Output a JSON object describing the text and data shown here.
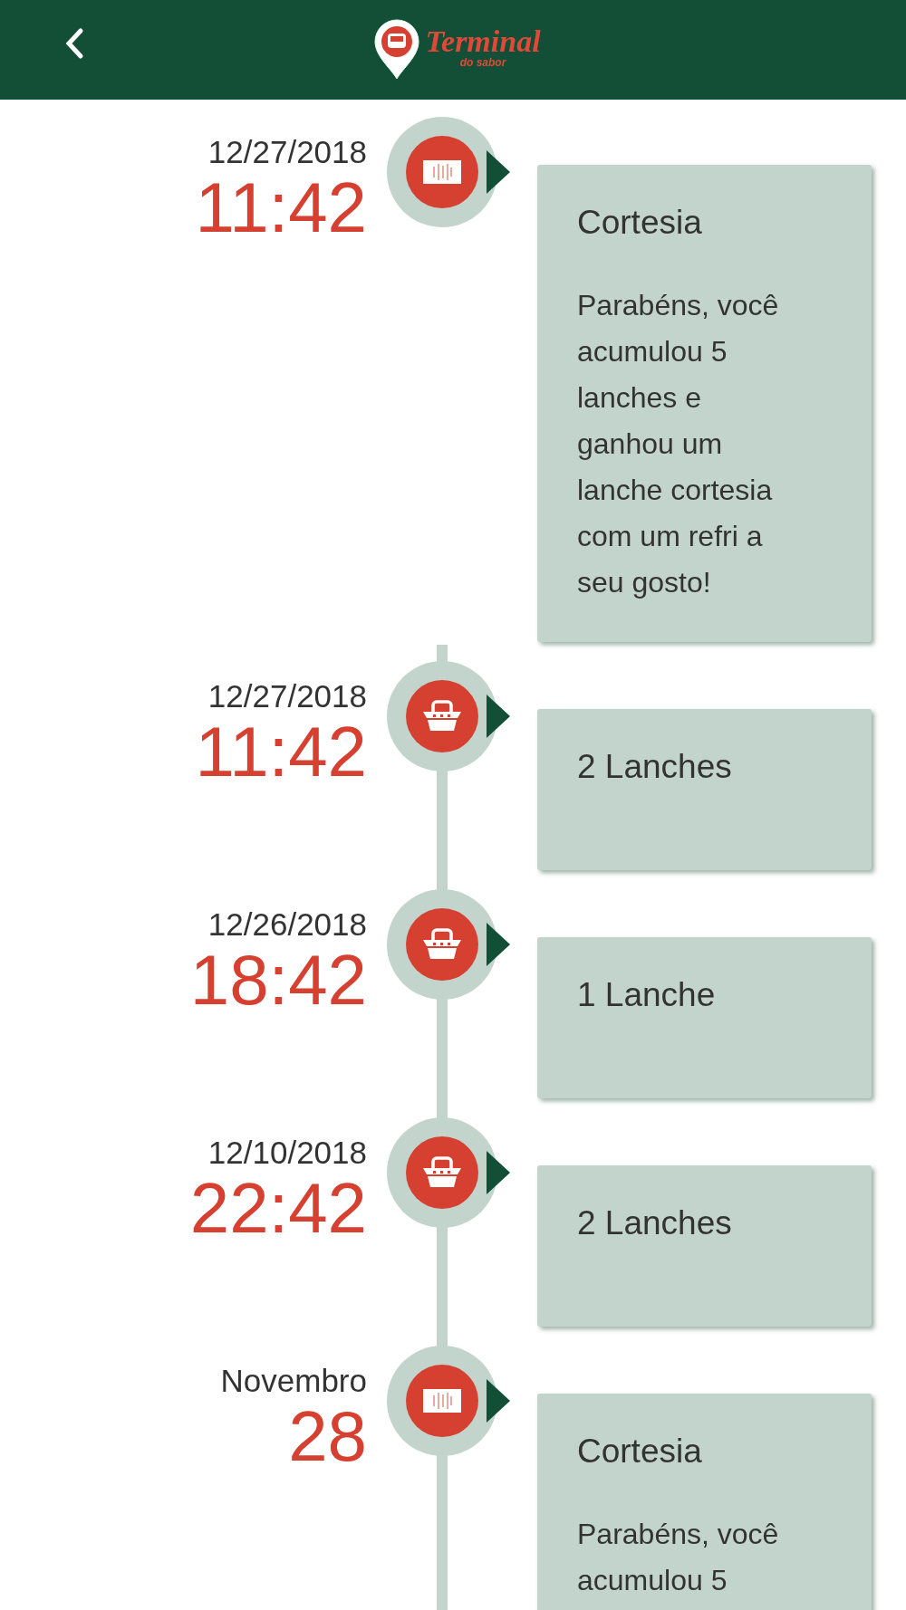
{
  "header": {
    "logo": {
      "title": "Terminal",
      "subtitle": "do sabor"
    }
  },
  "timeline": [
    {
      "kind": "reward",
      "date": "12/27/2018",
      "time": "11:42",
      "title": "Cortesia",
      "body": "Parabéns, você acumulou 5 lanches e ganhou um lanche cortesia com um refri a seu gosto!"
    },
    {
      "kind": "purchase",
      "date": "12/27/2018",
      "time": "11:42",
      "title": "2 Lanches"
    },
    {
      "kind": "purchase",
      "date": "12/26/2018",
      "time": "18:42",
      "title": "1 Lanche"
    },
    {
      "kind": "purchase",
      "date": "12/10/2018",
      "time": "22:42",
      "title": "2 Lanches"
    },
    {
      "kind": "reward",
      "date": "Novembro",
      "time": "28",
      "title": "Cortesia",
      "body": "Parabéns, você acumulou 5"
    }
  ]
}
